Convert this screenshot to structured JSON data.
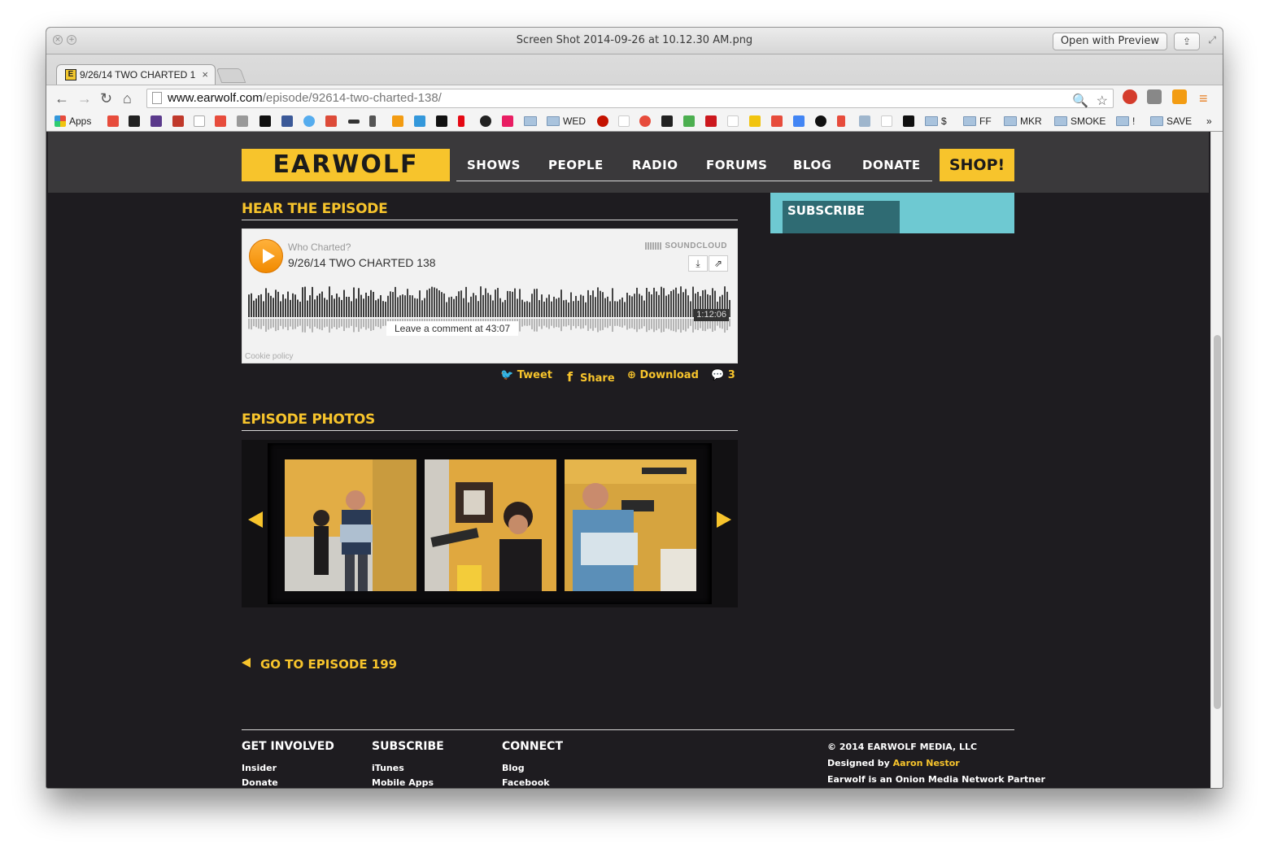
{
  "preview": {
    "title": "Screen Shot 2014-09-26 at 10.12.30 AM.png",
    "open_with": "Open with Preview"
  },
  "browser": {
    "tab_title": "9/26/14 TWO CHARTED 1",
    "url_host": "www.earwolf.com",
    "url_path": "/episode/92614-two-charted-138/",
    "bookmarks": {
      "apps": "Apps",
      "wed": "WED",
      "dollar": "$",
      "ff": "FF",
      "mkr": "MKR",
      "smoke": "SMOKE",
      "bang": "!",
      "save": "SAVE",
      "more": "»"
    }
  },
  "site": {
    "logo": "EARWOLF",
    "nav": [
      "SHOWS",
      "PEOPLE",
      "RADIO",
      "FORUMS",
      "BLOG",
      "DONATE"
    ],
    "shop": "SHOP!",
    "subscribe": "SUBSCRIBE",
    "hear_title": "HEAR THE EPISODE",
    "player": {
      "user": "Who Charted?",
      "track": "9/26/14 TWO CHARTED 138",
      "brand": "SOUNDCLOUD",
      "duration": "1:12:06",
      "comment_tip": "Leave a comment at 43:07",
      "cookie": "Cookie policy"
    },
    "share": {
      "tweet": "Tweet",
      "share": "Share",
      "download": "Download",
      "comments": "3"
    },
    "photos_title": "EPISODE PHOTOS",
    "go_episode": "GO TO EPISODE 199",
    "footer": {
      "get_involved": {
        "title": "GET INVOLVED",
        "links": [
          "Insider",
          "Donate"
        ]
      },
      "subscribe": {
        "title": "SUBSCRIBE",
        "links": [
          "iTunes",
          "Mobile Apps"
        ]
      },
      "connect": {
        "title": "CONNECT",
        "links": [
          "Blog",
          "Facebook"
        ]
      },
      "copyright": "© 2014 EARWOLF MEDIA, LLC",
      "designed_by": "Designed by",
      "designer": "Aaron Nestor",
      "partner": "Earwolf is an Onion Media Network Partner"
    }
  },
  "colors": {
    "accent": "#f7c42c",
    "page_bg": "#1e1c20",
    "header_bg": "#3a393b",
    "subscribe_bg": "#6ec9d2"
  }
}
